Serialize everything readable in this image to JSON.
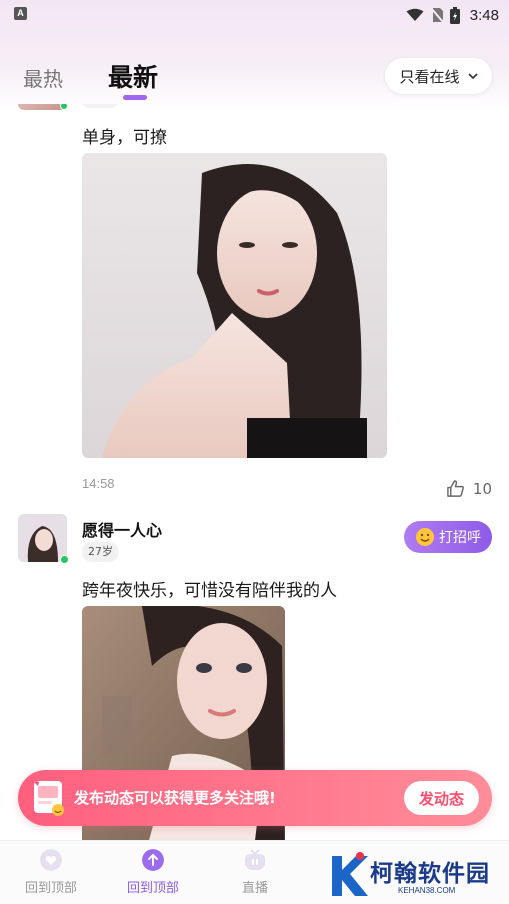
{
  "status_bar": {
    "time": "3:48",
    "app_icon_letter": "A"
  },
  "tabs": {
    "hot_label": "最热",
    "new_label": "最新",
    "filter_label": "只看在线"
  },
  "posts": [
    {
      "text": "单身，可撩",
      "time": "14:58",
      "likes": "10"
    },
    {
      "username": "愿得一人心",
      "age": "27岁",
      "text": "跨年夜快乐，可惜没有陪伴我的人",
      "greet_label": "打招呼"
    }
  ],
  "banner": {
    "text": "发布动态可以获得更多关注哦!",
    "button_label": "发动态"
  },
  "bottom_nav": [
    {
      "label": "回到顶部"
    },
    {
      "label": "回到顶部"
    },
    {
      "label": "直播"
    }
  ],
  "watermark": {
    "title": "柯翰软件园",
    "sub": "KEHAN38.COM"
  },
  "colors": {
    "accent": "#8e5be8",
    "banner": "#ff6f86",
    "online": "#22c55e"
  }
}
